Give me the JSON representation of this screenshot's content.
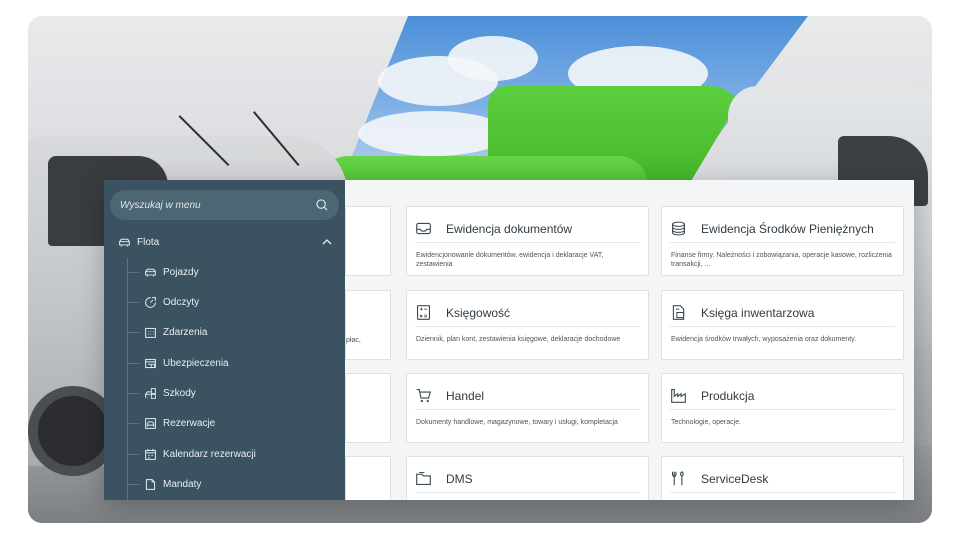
{
  "sidebar": {
    "search_placeholder": "Wyszukaj w menu",
    "section_label": "Flota",
    "items": [
      {
        "label": "Pojazdy",
        "icon": "car-icon"
      },
      {
        "label": "Odczyty",
        "icon": "gauge-icon"
      },
      {
        "label": "Zdarzenia",
        "icon": "calendar-grid-icon"
      },
      {
        "label": "Ubezpieczenia",
        "icon": "insurance-icon"
      },
      {
        "label": "Szkody",
        "icon": "damage-car-icon"
      },
      {
        "label": "Rezerwacje",
        "icon": "reservation-icon"
      },
      {
        "label": "Kalendarz rezerwacji",
        "icon": "calendar-icon"
      },
      {
        "label": "Mandaty",
        "icon": "document-icon"
      }
    ]
  },
  "partial_text": {
    "cut_desc": "płac,"
  },
  "cards": [
    {
      "title": "Ewidencja dokumentów",
      "icon": "inbox-icon",
      "desc": "Ewidencjonowanie dokumentów, ewidencja i deklaracje VAT, zestawienia"
    },
    {
      "title": "Ewidencja Środków Pieniężnych",
      "icon": "coins-icon",
      "desc": "Finanse firmy. Należności i zobowiązania, operacje kasowe, rozliczenia transakcji, ..."
    },
    {
      "title": "Księgowość",
      "icon": "calculator-icon",
      "desc": "Dziennik, plan kont, zestawienia księgowe, deklaracje dochodowe"
    },
    {
      "title": "Księga inwentarzowa",
      "icon": "inventory-book-icon",
      "desc": "Ewidencja środków trwałych, wyposażenia oraz dokumenty."
    },
    {
      "title": "Handel",
      "icon": "cart-icon",
      "desc": "Dokumenty handlowe, magazynowe, towary i usługi, kompletacja"
    },
    {
      "title": "Produkcja",
      "icon": "factory-icon",
      "desc": "Technologie, operacje."
    },
    {
      "title": "DMS",
      "icon": "folder-icon",
      "desc": ""
    },
    {
      "title": "ServiceDesk",
      "icon": "tools-icon",
      "desc": ""
    }
  ],
  "colors": {
    "sidebar_bg": "#3b5361",
    "search_bg": "#4c6673",
    "panel_bg": "#f4f5f6",
    "accent_green": "#4cbf2f"
  }
}
